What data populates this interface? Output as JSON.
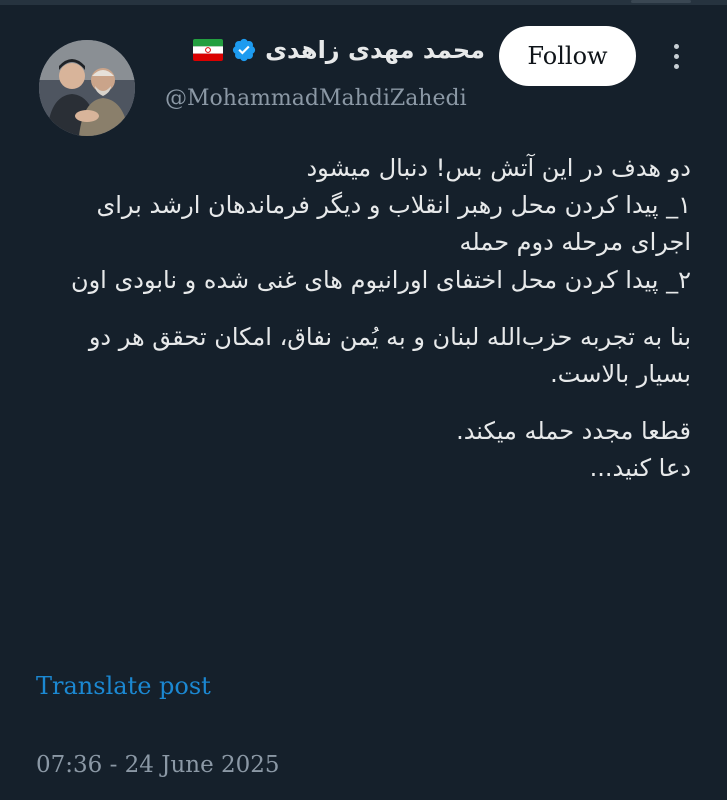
{
  "author": {
    "display_name": "محمد مهدی زاهدی",
    "handle": "@MohammadMahdiZahedi",
    "verified_icon": "verified-badge-icon",
    "flag_icon": "iran-flag-icon"
  },
  "follow_button": {
    "label": "Follow"
  },
  "more_menu": {
    "icon": "more-vertical-icon"
  },
  "tweet": {
    "paragraph_1": "دو هدف در این آتش بس! دنبال میشود\n۱_ پیدا کردن محل رهبر انقلاب و دیگر فرماندهان ارشد برای اجرای مرحله دوم حمله\n۲_ پیدا کردن محل اختفای اورانیوم های غنی شده و نابودی اون",
    "paragraph_2": "بنا به تجربه حزب‌الله لبنان و به یُمن نفاق، امکان تحقق هر دو بسیار بالاست.",
    "paragraph_3": "قطعا مجدد حمله میکند.\nدعا کنید..."
  },
  "translate_link": "Translate post",
  "timestamp": "07:36 - 24 June 2025",
  "colors": {
    "background": "#15202b",
    "text": "#e7e9ea",
    "muted": "#8b98a5",
    "link": "#1d9bf0",
    "verified": "#1d9bf0"
  }
}
